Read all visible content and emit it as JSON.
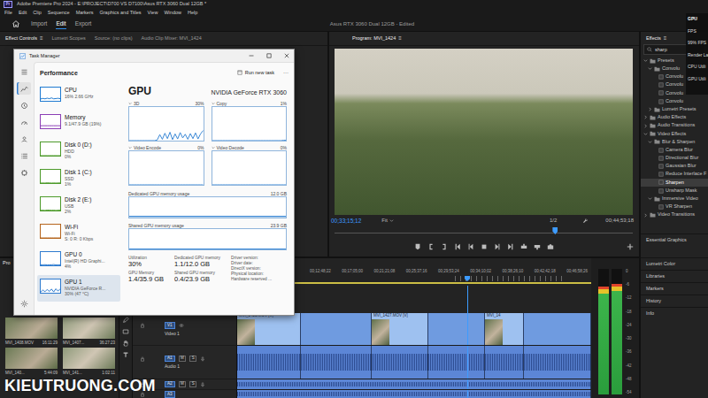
{
  "window": {
    "title": "Adobe Premiere Pro 2024 - E:\\PROJECT\\D700 VS D7100\\Asus RTX 3060 Dual 12GB *",
    "logo": "Pr"
  },
  "menu": [
    "File",
    "Edit",
    "Clip",
    "Sequence",
    "Markers",
    "Graphics and Titles",
    "View",
    "Window",
    "Help"
  ],
  "workspaces": [
    {
      "label": "Import",
      "selected": false
    },
    {
      "label": "Edit",
      "selected": true
    },
    {
      "label": "Export",
      "selected": false
    }
  ],
  "project_title": "Asus RTX 3060 Dual 12GB - Edited",
  "menu_glyph": "≡",
  "panel_tabs": [
    {
      "label": "Effect Controls",
      "selected": true
    },
    {
      "label": "Lumetri Scopes",
      "selected": false
    },
    {
      "label": "Source: (no clips)",
      "selected": false
    },
    {
      "label": "Audio Clip Mixer: MVI_1424",
      "selected": false
    }
  ],
  "program": {
    "tab": "Program: MVI_1424",
    "timecode": "00;33;15;12",
    "fit": "Fit",
    "resolution": "1/2",
    "duration": "00;44;53;18",
    "playhead": 0.74
  },
  "effects": {
    "title": "Effects",
    "search": "sharp",
    "tree": [
      {
        "label": "Presets",
        "depth": 0,
        "kind": "folder",
        "expanded": true,
        "selected": false
      },
      {
        "label": "Convolu",
        "depth": 1,
        "kind": "folder",
        "expanded": true,
        "selected": false
      },
      {
        "label": "Convolu",
        "depth": 2,
        "kind": "effect",
        "expanded": false,
        "selected": false
      },
      {
        "label": "Convolu",
        "depth": 2,
        "kind": "effect",
        "expanded": false,
        "selected": false
      },
      {
        "label": "Convolu",
        "depth": 2,
        "kind": "effect",
        "expanded": false,
        "selected": false
      },
      {
        "label": "Convolu",
        "depth": 2,
        "kind": "effect",
        "expanded": false,
        "selected": false
      },
      {
        "label": "Lumetri Presets",
        "depth": 1,
        "kind": "folder",
        "expanded": false,
        "selected": false
      },
      {
        "label": "Audio Effects",
        "depth": 0,
        "kind": "folder",
        "expanded": false,
        "selected": false
      },
      {
        "label": "Audio Transitions",
        "depth": 0,
        "kind": "folder",
        "expanded": false,
        "selected": false
      },
      {
        "label": "Video Effects",
        "depth": 0,
        "kind": "folder",
        "expanded": true,
        "selected": false
      },
      {
        "label": "Blur & Sharpen",
        "depth": 1,
        "kind": "folder",
        "expanded": true,
        "selected": false
      },
      {
        "label": "Camera Blur",
        "depth": 2,
        "kind": "effect",
        "expanded": false,
        "selected": false
      },
      {
        "label": "Directional Blur",
        "depth": 2,
        "kind": "effect",
        "expanded": false,
        "selected": false
      },
      {
        "label": "Gaussian Blur",
        "depth": 2,
        "kind": "effect",
        "expanded": false,
        "selected": false
      },
      {
        "label": "Reduce Interlace F",
        "depth": 2,
        "kind": "effect",
        "expanded": false,
        "selected": false
      },
      {
        "label": "Sharpen",
        "depth": 2,
        "kind": "effect",
        "expanded": false,
        "selected": true
      },
      {
        "label": "Unsharp Mask",
        "depth": 2,
        "kind": "effect",
        "expanded": false,
        "selected": false
      },
      {
        "label": "Immersive Video",
        "depth": 1,
        "kind": "folder",
        "expanded": true,
        "selected": false
      },
      {
        "label": "VR Sharpen",
        "depth": 2,
        "kind": "effect",
        "expanded": false,
        "selected": false
      },
      {
        "label": "Video Transitions",
        "depth": 0,
        "kind": "folder",
        "expanded": false,
        "selected": false
      }
    ],
    "sections": [
      "Essential Graphics",
      "Lumetri Color",
      "Libraries",
      "Markers",
      "History",
      "Info"
    ]
  },
  "overlay": {
    "items": [
      "GPU",
      "FPS",
      "99% FPS",
      "Render La",
      "CPU Utili",
      "GPU Utili"
    ]
  },
  "project": {
    "tab": "Pro",
    "items": [
      {
        "name": "MVI_1408.MOV",
        "duration": "16:11:29"
      },
      {
        "name": "MVI_1407...",
        "duration": "36:27:23"
      },
      {
        "name": "MVI_140...",
        "duration": "5:44:09"
      },
      {
        "name": "MVI_141...",
        "duration": "1:02:11"
      }
    ]
  },
  "timeline": {
    "ruler": [
      "00;12;48;22",
      "00;17;05;00",
      "00;21;21;08",
      "00;25;37;16",
      "00;29;53;24",
      "00;34;10;02",
      "00;38;26;10",
      "00;42;42;18",
      "00;46;58;26"
    ],
    "playhead": 0.65,
    "tracks": [
      {
        "label": "V1",
        "name": "Video 1",
        "kind": "video",
        "buttons": [],
        "clips": [
          {
            "label": "MVI_1425.MOV [V]",
            "span": 0.18,
            "thumbs": true
          },
          {
            "label": "",
            "span": 0.2,
            "thumbs": false
          },
          {
            "label": "MVI_1427.MOV [V]",
            "span": 0.16,
            "thumbs": true
          },
          {
            "label": "",
            "span": 0.16,
            "thumbs": false
          },
          {
            "label": "MVI_14",
            "span": 0.11,
            "thumbs": true
          },
          {
            "label": "",
            "span": 0.19,
            "thumbs": false
          }
        ]
      },
      {
        "label": "A1",
        "name": "Audio 1",
        "kind": "audio",
        "buttons": [
          "M",
          "S"
        ],
        "clips": [
          {
            "label": "",
            "span": 0.18,
            "thumbs": false
          },
          {
            "label": "",
            "span": 0.2,
            "thumbs": false
          },
          {
            "label": "",
            "span": 0.16,
            "thumbs": false
          },
          {
            "label": "",
            "span": 0.16,
            "thumbs": false
          },
          {
            "label": "",
            "span": 0.11,
            "thumbs": false
          },
          {
            "label": "",
            "span": 0.19,
            "thumbs": false
          }
        ]
      },
      {
        "label": "A2",
        "name": "",
        "kind": "audio",
        "buttons": [
          "M",
          "S"
        ],
        "clips": [
          {
            "label": "",
            "span": 1,
            "thumbs": false
          }
        ]
      },
      {
        "label": "A3",
        "name": "",
        "kind": "audio",
        "buttons": [],
        "clips": [
          {
            "label": "",
            "span": 1,
            "thumbs": false
          }
        ]
      }
    ]
  },
  "meter": {
    "channels": [
      {
        "level": 0.86
      },
      {
        "level": 0.88
      }
    ],
    "scale": [
      "0",
      "-6",
      "-12",
      "-18",
      "-24",
      "-30",
      "-36",
      "-42",
      "-48",
      "-54"
    ]
  },
  "task_manager": {
    "title": "Task Manager",
    "section": "Performance",
    "run_button": "Run new task",
    "more": "···",
    "rail": [
      {
        "selected": false
      },
      {
        "selected": true
      },
      {
        "selected": false
      },
      {
        "selected": false
      },
      {
        "selected": false
      },
      {
        "selected": false
      },
      {
        "selected": false
      },
      {
        "selected": false
      }
    ],
    "resources": [
      {
        "name": "CPU",
        "lines": [
          "16% 2.66 GHz"
        ],
        "selected": false,
        "color": "#1f7ad1",
        "values": [
          14,
          18,
          15,
          20,
          16,
          22,
          15,
          17,
          19,
          16
        ]
      },
      {
        "name": "Memory",
        "lines": [
          "9.1/47.9 GB (19%)"
        ],
        "selected": false,
        "color": "#8b3fb5",
        "values": [
          19,
          19,
          19,
          19,
          19,
          19,
          19,
          19,
          19,
          19
        ]
      },
      {
        "name": "Disk 0 (D:)",
        "lines": [
          "HDD",
          "0%"
        ],
        "selected": false,
        "color": "#4c9a2a",
        "values": [
          0,
          0,
          0,
          0,
          0,
          0,
          0,
          0,
          0,
          0
        ]
      },
      {
        "name": "Disk 1 (C:)",
        "lines": [
          "SSD",
          "1%"
        ],
        "selected": false,
        "color": "#4c9a2a",
        "values": [
          0,
          1,
          0,
          2,
          1,
          0,
          1,
          0,
          1,
          1
        ]
      },
      {
        "name": "Disk 2 (E:)",
        "lines": [
          "USB",
          "2%"
        ],
        "selected": false,
        "color": "#4c9a2a",
        "values": [
          1,
          2,
          0,
          3,
          2,
          1,
          2,
          0,
          2,
          2
        ]
      },
      {
        "name": "Wi-Fi",
        "lines": [
          "Wi-Fi",
          "S: 0 R: 0 Kbps"
        ],
        "selected": false,
        "color": "#b5651d",
        "values": [
          0,
          0,
          0,
          0,
          0,
          0,
          0,
          0,
          0,
          0
        ]
      },
      {
        "name": "GPU 0",
        "lines": [
          "Intel(R) HD Graphi...",
          "4%"
        ],
        "selected": false,
        "color": "#2e7bcf",
        "values": [
          3,
          4,
          5,
          3,
          4,
          4,
          6,
          3,
          4,
          4
        ]
      },
      {
        "name": "GPU 1",
        "lines": [
          "NVIDIA GeForce R...",
          "30% (47 °C)"
        ],
        "selected": true,
        "color": "#2e7bcf",
        "values": [
          5,
          20,
          8,
          25,
          10,
          28,
          6,
          30,
          12,
          30
        ]
      }
    ],
    "heading": "GPU",
    "model": "NVIDIA GeForce RTX 3060",
    "engines": [
      {
        "label": "3D",
        "reading": "30%",
        "values": [
          0,
          0,
          0,
          0,
          0,
          0,
          0,
          0,
          0,
          0,
          0,
          2,
          18,
          4,
          22,
          6,
          25,
          3,
          20,
          5,
          24,
          8,
          19,
          4,
          21,
          6,
          23,
          5,
          20,
          30
        ]
      },
      {
        "label": "Copy",
        "reading": "1%",
        "values": [
          0,
          0,
          0,
          0,
          0,
          0,
          0,
          0,
          0,
          0,
          0,
          0,
          0,
          0,
          0,
          0,
          0,
          0,
          0,
          0,
          0,
          0,
          0,
          0,
          0,
          0,
          0,
          0,
          1,
          1
        ]
      },
      {
        "label": "Video Encode",
        "reading": "0%",
        "values": [
          0,
          0,
          0,
          0,
          0,
          0,
          0,
          0,
          0,
          0,
          0,
          0,
          0,
          0,
          0,
          0,
          0,
          0,
          0,
          0,
          0,
          0,
          0,
          0,
          0,
          0,
          0,
          0,
          0,
          0
        ]
      },
      {
        "label": "Video Decode",
        "reading": "0%",
        "values": [
          0,
          0,
          0,
          0,
          0,
          0,
          0,
          0,
          0,
          0,
          0,
          0,
          0,
          0,
          0,
          0,
          0,
          0,
          0,
          0,
          0,
          0,
          0,
          0,
          0,
          0,
          0,
          0,
          0,
          0
        ]
      }
    ],
    "memory_graphs": [
      {
        "label": "Dedicated GPU memory usage",
        "max": "12.0 GB",
        "level": 0.09
      },
      {
        "label": "Shared GPU memory usage",
        "max": "23.9 GB",
        "level": 0.02
      }
    ],
    "stats": [
      {
        "label": "Utilization",
        "value": "30%"
      },
      {
        "label": "GPU Memory",
        "value": "1.4/35.9 GB"
      },
      {
        "label": "Dedicated GPU memory",
        "value": "1.1/12.0 GB"
      },
      {
        "label": "Shared GPU memory",
        "value": "0.4/23.9 GB"
      }
    ],
    "info": [
      "Driver version:",
      "Driver date:",
      "DirectX version:",
      "Physical location:",
      "Hardware reserved ..."
    ]
  },
  "watermark": "KIEUTRUONG.COM"
}
